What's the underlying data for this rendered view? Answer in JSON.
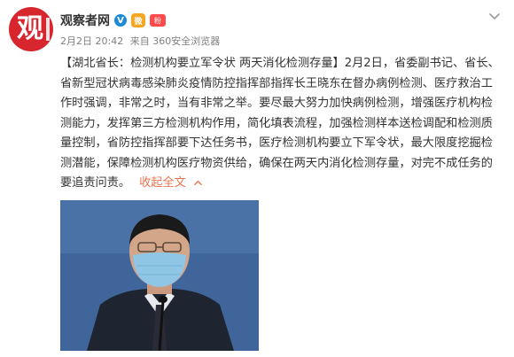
{
  "author": {
    "name": "观察者网",
    "avatar_text": "观",
    "vip_badge": "V",
    "badge_text": "微",
    "fan_badge": "粉"
  },
  "post_meta": {
    "time": "2月2日 20:42",
    "source": "来自 360安全浏览器"
  },
  "post": {
    "topic": "【湖北省长：检测机构要立军令状 两天消化检测存量】",
    "body": "2月2日，省委副书记、省长、省新型冠状病毒感染肺炎疫情防控指挥部指挥长王晓东在督办病例检测、医疗救治工作时强调，非常之时，当有非常之举。要尽最大努力加快病例检测，增强医疗机构检测能力，发挥第三方检测机构作用，简化填表流程，加强检测样本送检调配和检测质量控制，省防控指挥部要下达任务书，医疗检测机构要立下军令状，最大限度挖掘检测潜能，保障检测机构医疗物资供给，确保在两天内消化检测存量，对完不成任务的要追责问责。",
    "collapse_label": "收起全文"
  },
  "colors": {
    "accent_link": "#eb7350",
    "avatar_bg": "#d7262d",
    "vip_blue": "#1d8ad6"
  },
  "icons": {
    "menu": "chevron-down-icon",
    "collapse": "chevron-up-icon"
  }
}
